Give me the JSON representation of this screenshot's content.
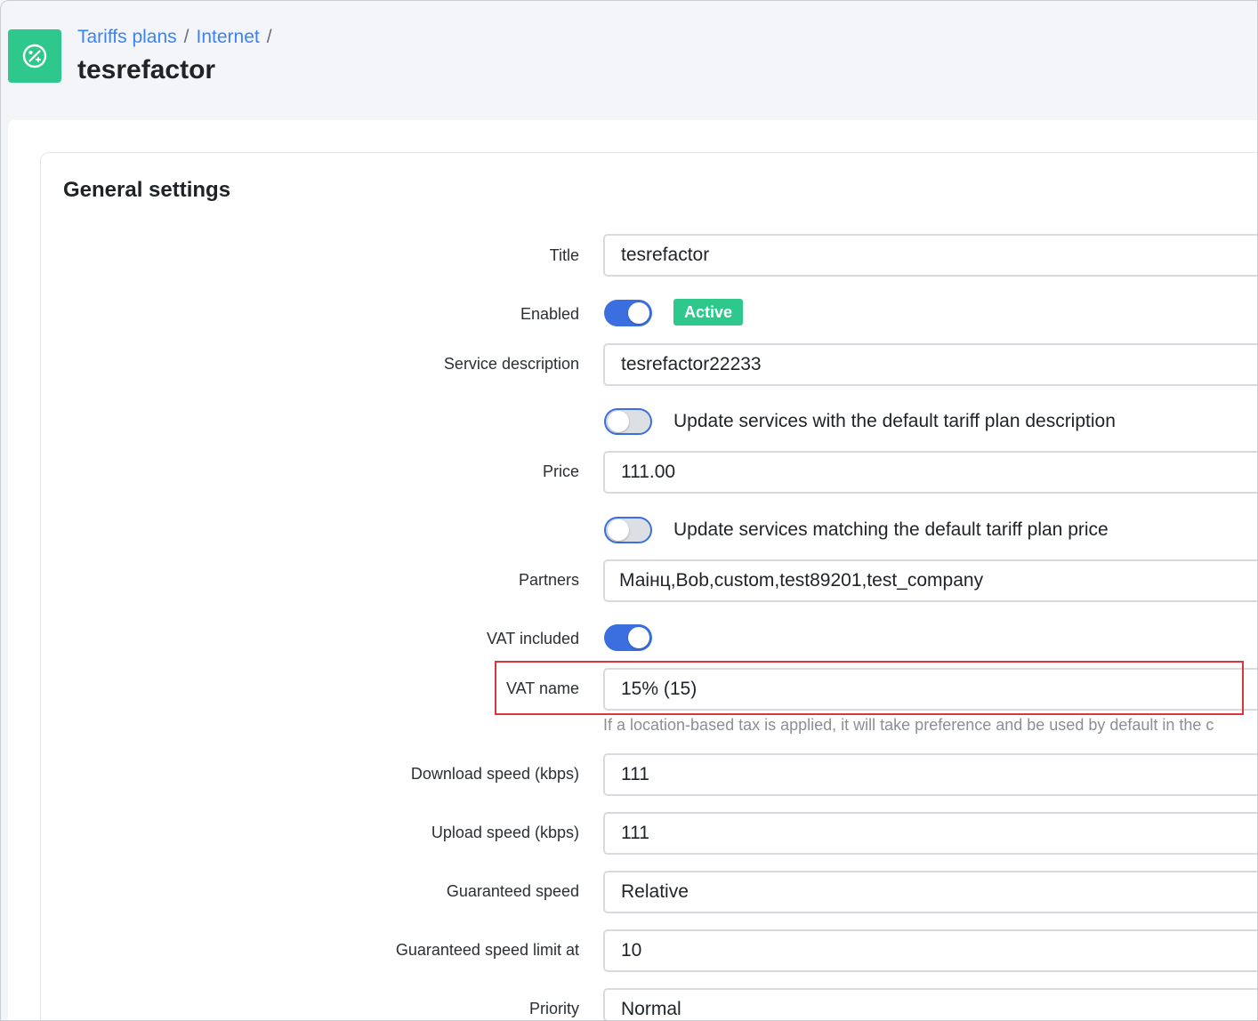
{
  "header": {
    "breadcrumb": [
      "Tariffs plans",
      "Internet"
    ],
    "title": "tesrefactor",
    "module_icon": "percent-tag-icon"
  },
  "section": {
    "title": "General settings"
  },
  "form": {
    "title": {
      "label": "Title",
      "value": "tesrefactor"
    },
    "enabled": {
      "label": "Enabled",
      "state": true,
      "badge": "Active"
    },
    "service_description": {
      "label": "Service description",
      "value": "tesrefactor22233"
    },
    "update_description": {
      "text": "Update services with the default tariff plan description",
      "state": false
    },
    "price": {
      "label": "Price",
      "value": "111.00"
    },
    "update_price": {
      "text": "Update services matching the default tariff plan price",
      "state": false
    },
    "partners": {
      "label": "Partners",
      "value": "Маінц,Bob,custom,test89201,test_company"
    },
    "vat_included": {
      "label": "VAT included",
      "state": true
    },
    "vat_name": {
      "label": "VAT name",
      "value": "15% (15)",
      "hint": "If a location-based tax is applied, it will take preference and be used by default in the c"
    },
    "download_speed": {
      "label": "Download speed (kbps)",
      "value": "111"
    },
    "upload_speed": {
      "label": "Upload speed (kbps)",
      "value": "111"
    },
    "guaranteed_speed": {
      "label": "Guaranteed speed",
      "value": "Relative"
    },
    "guaranteed_speed_limit": {
      "label": "Guaranteed speed limit at",
      "value": "10"
    },
    "priority": {
      "label": "Priority",
      "value": "Normal"
    }
  },
  "colors": {
    "accent": "#3b6fe0",
    "success": "#2fc88c",
    "highlight": "#d9363e"
  }
}
